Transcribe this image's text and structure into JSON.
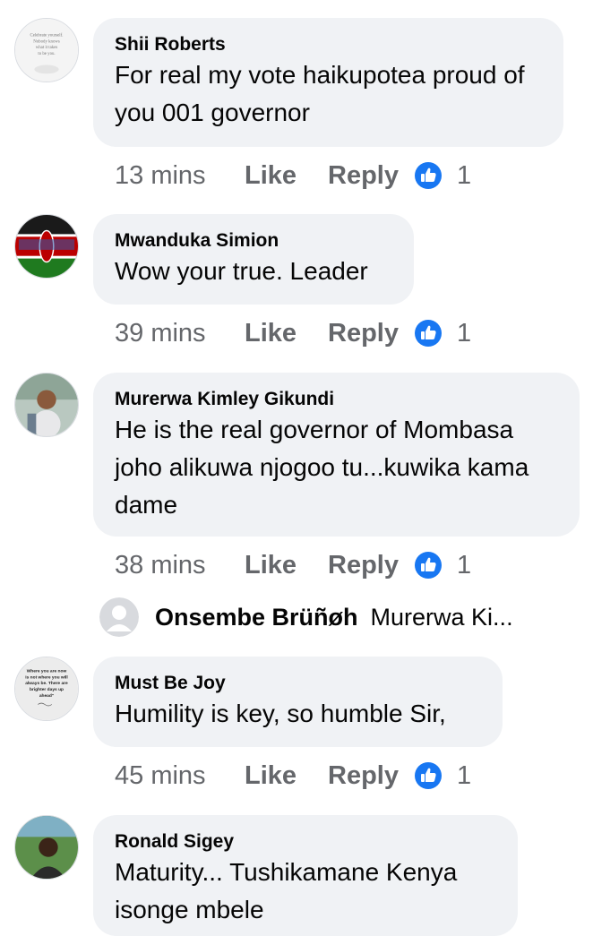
{
  "comments": [
    {
      "author": "Shii Roberts",
      "text": "For real my vote haikupotea proud of you 001 governor",
      "time": "13 mins",
      "like": "Like",
      "reply": "Reply",
      "reactions": "1",
      "avatar_text": "Celebrate yourself. Nobody knows what it takes to be you."
    },
    {
      "author": "Mwanduka Simion",
      "text": "Wow your true. Leader",
      "time": "39 mins",
      "like": "Like",
      "reply": "Reply",
      "reactions": "1"
    },
    {
      "author": "Murerwa Kimley Gikundi",
      "text": "He is the real governor of Mombasa joho alikuwa njogoo tu...kuwika kama dame",
      "time": "38 mins",
      "like": "Like",
      "reply": "Reply",
      "reactions": "1"
    },
    {
      "author": "Must Be Joy",
      "text": "Humility is key, so humble Sir,",
      "time": "45 mins",
      "like": "Like",
      "reply": "Reply",
      "reactions": "1",
      "avatar_text": "Where you are now is not where you will always be. There are brighter days up ahead"
    },
    {
      "author": "Ronald Sigey",
      "text": "Maturity... Tushikamane Kenya isonge mbele"
    }
  ],
  "reply_preview": {
    "author": "Onsembe Brüñøh",
    "text": "Murerwa Ki..."
  },
  "colors": {
    "bubble": "#f0f2f5",
    "meta": "#65676b",
    "like_blue": "#1877f2"
  },
  "icons": {
    "reaction": "like-thumb-icon",
    "default_avatar": "default-avatar-icon"
  }
}
